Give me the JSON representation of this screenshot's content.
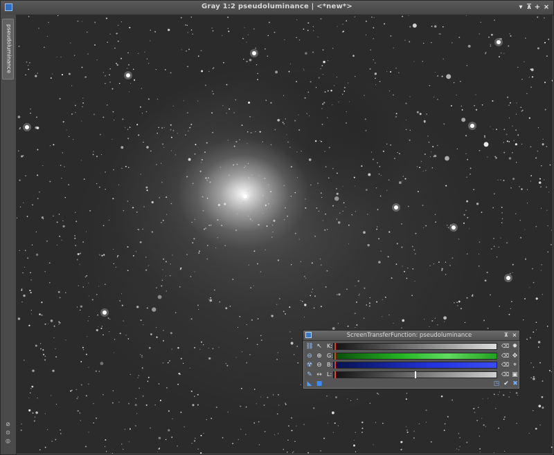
{
  "window": {
    "title": "Gray 1:2 pseudoluminance | <*new*>",
    "buttons": {
      "shade": "▾",
      "restore": "⊼",
      "maximize": "+",
      "close": "×"
    },
    "side_tab_label": "pseudoluminance",
    "side_icons": [
      "⊘",
      "⊙",
      "◎"
    ]
  },
  "stf": {
    "title": "ScreenTransferFunction: pseudoluminance",
    "title_buttons": {
      "shade": "⊼",
      "close": "×"
    },
    "rows": [
      {
        "label": "K:",
        "left_icon": "link-icon",
        "left_glyph": "⛓",
        "mid_icon": "pointer-icon",
        "mid_glyph": "↖",
        "track_color": "#dddddd"
      },
      {
        "label": "G:",
        "left_icon": "zoom-out-icon",
        "left_glyph": "⊖",
        "mid_icon": "zoom-in-icon",
        "mid_glyph": "⊕",
        "track_color": "#22b222"
      },
      {
        "label": "B:",
        "left_icon": "radiation-icon",
        "left_glyph": "☢",
        "mid_icon": "zoom-out-icon",
        "mid_glyph": "⊖",
        "track_color": "#2233dd"
      },
      {
        "label": "L:",
        "left_icon": "wrench-icon",
        "left_glyph": "✎",
        "mid_icon": "pan-icon",
        "mid_glyph": "↔",
        "track_color": "#cfcfcf"
      }
    ],
    "right_icons": [
      {
        "name": "settings-icon",
        "glyph": "✹"
      },
      {
        "name": "crosshair-icon",
        "glyph": "✥"
      },
      {
        "name": "target-icon",
        "glyph": "⌖"
      },
      {
        "name": "monitor-icon",
        "glyph": "▣"
      }
    ],
    "bottom": {
      "new_instance_glyph": "◣",
      "apply_global_glyph": "■",
      "preview_glyph": "◳",
      "apply_glyph": "✔",
      "reset_glyph": "✖"
    }
  }
}
